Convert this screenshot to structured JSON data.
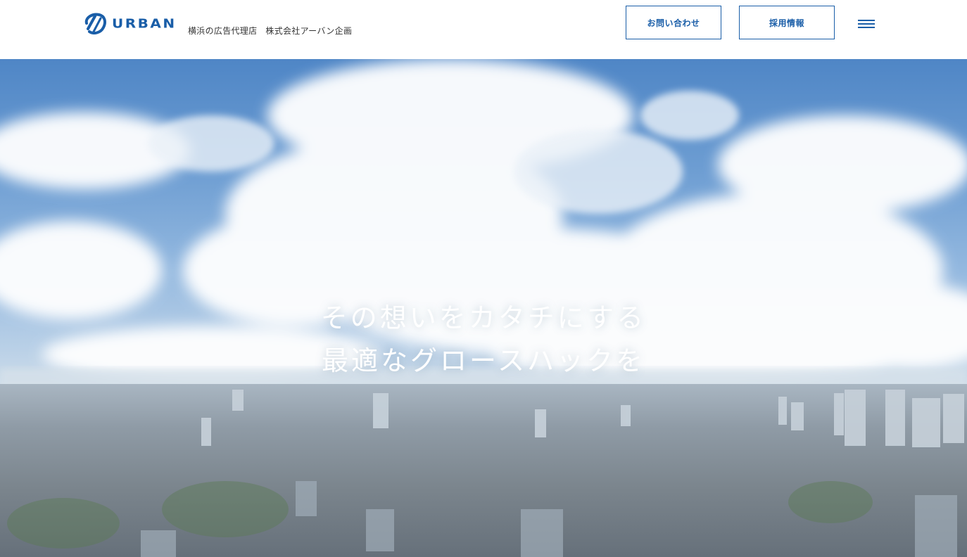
{
  "brand": {
    "logo_text": "URBAN",
    "tagline_part1": "横浜の広告代理店",
    "tagline_part2": "株式会社アーバン企画",
    "color": "#1a5ea8"
  },
  "header": {
    "contact_label": "お問い合わせ",
    "recruit_label": "採用情報",
    "menu_icon": "hamburger-icon"
  },
  "hero": {
    "line1": "その想いをカタチにする",
    "line2": "最適なグロースハックを",
    "background": "aerial-city-sky-image"
  }
}
